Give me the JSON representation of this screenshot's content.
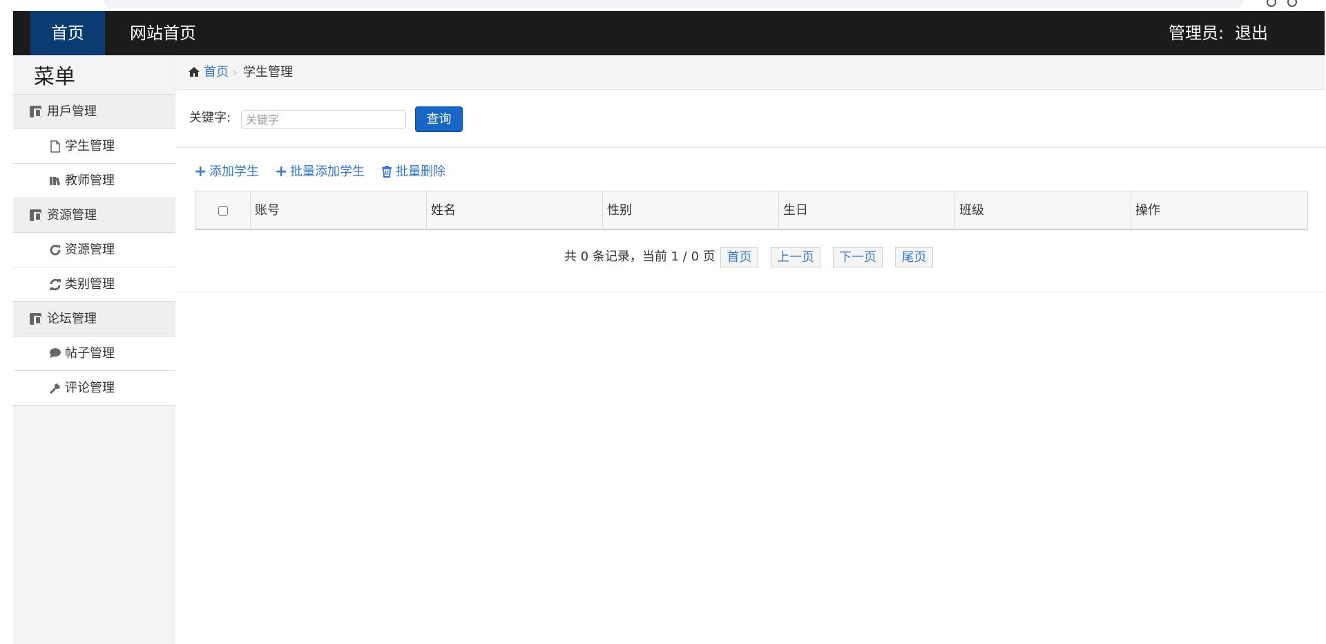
{
  "navbar": {
    "home": "首页",
    "site_home": "网站首页",
    "admin_label": "管理员:",
    "logout": "退出"
  },
  "sidebar": {
    "title": "菜单",
    "groups": [
      {
        "label": "用戶管理",
        "items": [
          {
            "label": "学生管理",
            "icon": "file-icon"
          },
          {
            "label": "教师管理",
            "icon": "books-icon"
          }
        ]
      },
      {
        "label": "资源管理",
        "items": [
          {
            "label": "资源管理",
            "icon": "refresh-icon"
          },
          {
            "label": "类别管理",
            "icon": "sync-icon"
          }
        ]
      },
      {
        "label": "论坛管理",
        "items": [
          {
            "label": "帖子管理",
            "icon": "comment-icon"
          },
          {
            "label": "评论管理",
            "icon": "wrench-icon"
          }
        ]
      }
    ]
  },
  "breadcrumb": {
    "home": "首页",
    "current": "学生管理"
  },
  "search": {
    "label": "关键字:",
    "placeholder": "关键字",
    "value": "",
    "button": "查询"
  },
  "actions": {
    "add": "添加学生",
    "batch_add": "批量添加学生",
    "batch_delete": "批量删除"
  },
  "table": {
    "columns": [
      "账号",
      "姓名",
      "性别",
      "生日",
      "班级",
      "操作"
    ],
    "rows": []
  },
  "pager": {
    "info": "共 0 条记录，当前 1 / 0 页",
    "first": "首页",
    "prev": "上一页",
    "next": "下一页",
    "last": "尾页"
  },
  "colors": {
    "navbar": "#1b1b1b",
    "nav_active": "#0a3c73",
    "link": "#3a7ac1",
    "primary_button": "#1666c5"
  }
}
